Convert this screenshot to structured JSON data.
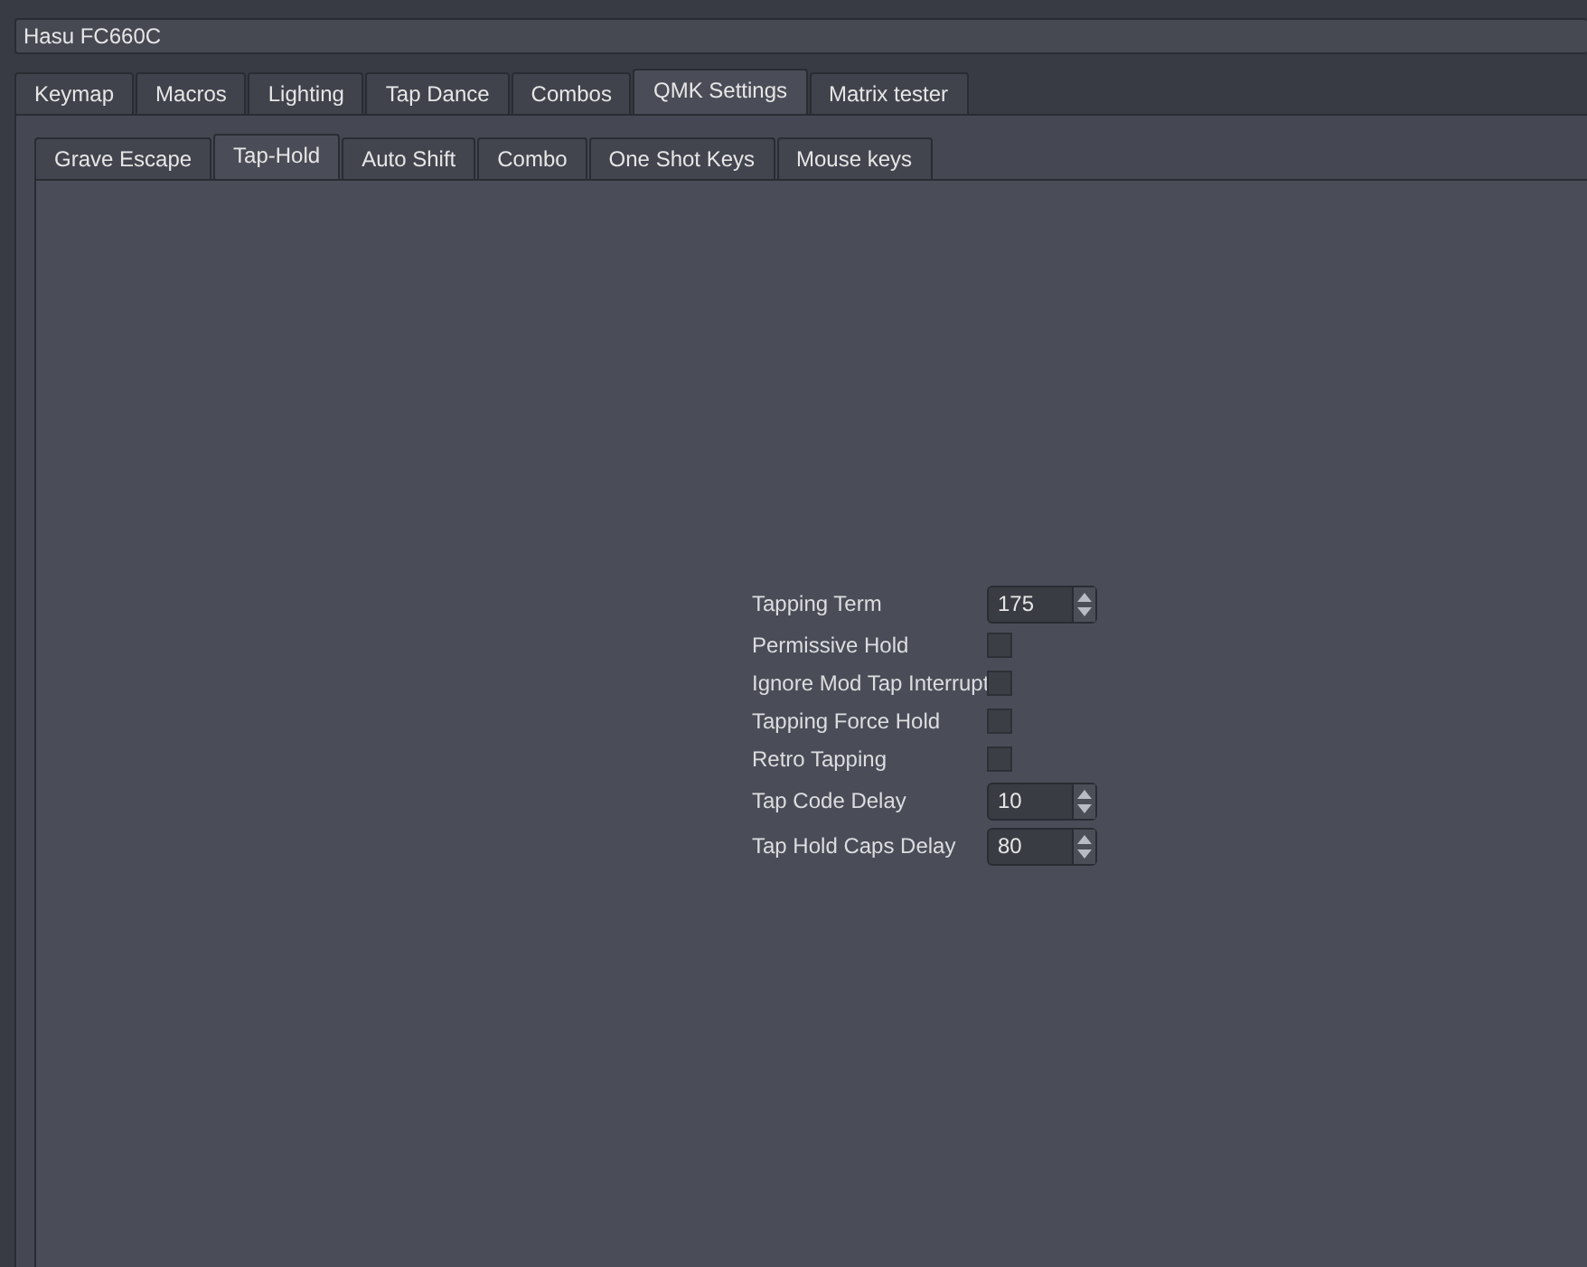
{
  "device_selector": {
    "value": "Hasu FC660C"
  },
  "tabs": [
    {
      "label": "Keymap",
      "selected": false
    },
    {
      "label": "Macros",
      "selected": false
    },
    {
      "label": "Lighting",
      "selected": false
    },
    {
      "label": "Tap Dance",
      "selected": false
    },
    {
      "label": "Combos",
      "selected": false
    },
    {
      "label": "QMK Settings",
      "selected": true
    },
    {
      "label": "Matrix tester",
      "selected": false
    }
  ],
  "subtabs": [
    {
      "label": "Grave Escape",
      "selected": false
    },
    {
      "label": "Tap-Hold",
      "selected": true
    },
    {
      "label": "Auto Shift",
      "selected": false
    },
    {
      "label": "Combo",
      "selected": false
    },
    {
      "label": "One Shot Keys",
      "selected": false
    },
    {
      "label": "Mouse keys",
      "selected": false
    }
  ],
  "settings": [
    {
      "kind": "spinbox",
      "label": "Tapping Term",
      "value": "175"
    },
    {
      "kind": "checkbox",
      "label": "Permissive Hold",
      "checked": false
    },
    {
      "kind": "checkbox",
      "label": "Ignore Mod Tap Interrupt",
      "checked": false
    },
    {
      "kind": "checkbox",
      "label": "Tapping Force Hold",
      "checked": false
    },
    {
      "kind": "checkbox",
      "label": "Retro Tapping",
      "checked": false
    },
    {
      "kind": "spinbox",
      "label": "Tap Code Delay",
      "value": "10"
    },
    {
      "kind": "spinbox",
      "label": "Tap Hold Caps Delay",
      "value": "80"
    }
  ]
}
